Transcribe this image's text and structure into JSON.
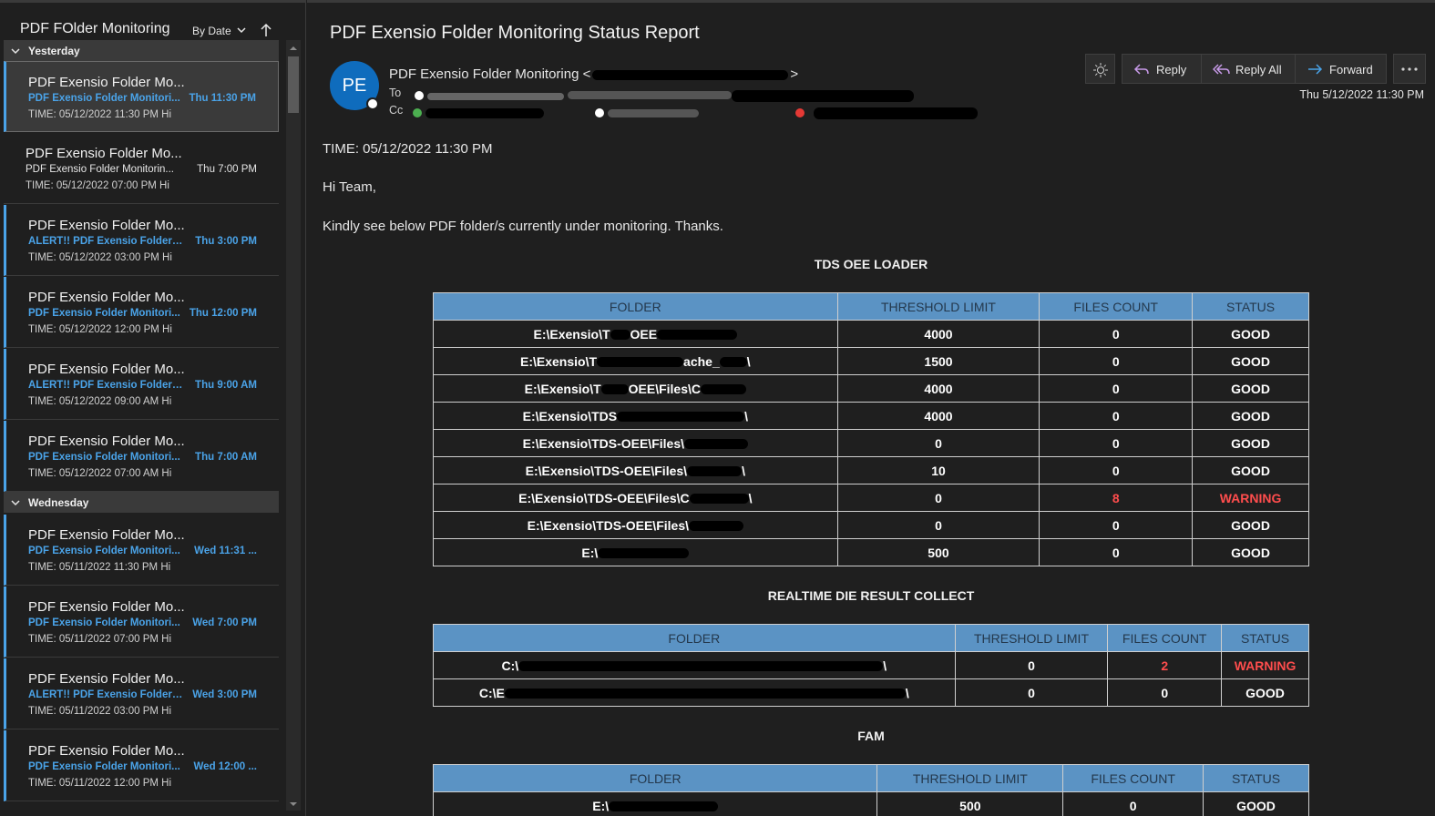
{
  "list": {
    "folder_title": "PDF FOlder Monitoring",
    "sort_label": "By Date",
    "groups": [
      {
        "label": "Yesterday"
      },
      {
        "label": "Wednesday"
      }
    ],
    "messages": [
      {
        "from": "PDF Exensio Folder Mo...",
        "subject": "PDF Exensio Folder Monitori...",
        "time": "Thu 11:30 PM",
        "preview": "TIME: 05/12/2022 11:30 PM  Hi",
        "state": "selected"
      },
      {
        "from": "PDF Exensio Folder Mo...",
        "subject": "PDF Exensio Folder Monitorin...",
        "time": "Thu 7:00 PM",
        "preview": "TIME: 05/12/2022 07:00 PM  Hi",
        "state": "read"
      },
      {
        "from": "PDF Exensio Folder Mo...",
        "subject": "ALERT!! PDF Exensio Folder ...",
        "time": "Thu 3:00 PM",
        "preview": "TIME: 05/12/2022 03:00 PM  Hi",
        "state": "unread"
      },
      {
        "from": "PDF Exensio Folder Mo...",
        "subject": "PDF Exensio Folder Monitori...",
        "time": "Thu 12:00 PM",
        "preview": "TIME: 05/12/2022 12:00 PM  Hi",
        "state": "unread"
      },
      {
        "from": "PDF Exensio Folder Mo...",
        "subject": "ALERT!! PDF Exensio Folder ...",
        "time": "Thu 9:00 AM",
        "preview": "TIME: 05/12/2022 09:00 AM  Hi",
        "state": "unread"
      },
      {
        "from": "PDF Exensio Folder Mo...",
        "subject": "PDF Exensio Folder Monitori...",
        "time": "Thu 7:00 AM",
        "preview": "TIME: 05/12/2022 07:00 AM  Hi",
        "state": "unread"
      },
      {
        "from": "PDF Exensio Folder Mo...",
        "subject": "PDF Exensio Folder Monitori...",
        "time": "Wed 11:31 ...",
        "preview": "TIME: 05/11/2022 11:30 PM  Hi",
        "state": "unread"
      },
      {
        "from": "PDF Exensio Folder Mo...",
        "subject": "PDF Exensio Folder Monitori...",
        "time": "Wed 7:00 PM",
        "preview": "TIME: 05/11/2022 07:00 PM  Hi",
        "state": "unread"
      },
      {
        "from": "PDF Exensio Folder Mo...",
        "subject": "ALERT!! PDF Exensio Folder ...",
        "time": "Wed 3:00 PM",
        "preview": "TIME: 05/11/2022 03:00 PM  Hi",
        "state": "unread"
      },
      {
        "from": "PDF Exensio Folder Mo...",
        "subject": "PDF Exensio Folder Monitori...",
        "time": "Wed 12:00 ...",
        "preview": "TIME: 05/11/2022 12:00 PM  Hi",
        "state": "unread"
      }
    ]
  },
  "email": {
    "subject": "PDF Exensio Folder Monitoring Status Report",
    "avatar_initials": "PE",
    "sender": "PDF Exensio Folder Monitoring <",
    "sender_end": ">",
    "to_label": "To",
    "cc_label": "Cc",
    "date": "Thu 5/12/2022 11:30 PM",
    "actions": {
      "reply": "Reply",
      "reply_all": "Reply All",
      "forward": "Forward"
    },
    "accent": "#0f6cbd",
    "body": {
      "time_line": "TIME: 05/12/2022 11:30 PM",
      "greeting": "Hi Team,",
      "intro": "Kindly see below PDF folder/s currently under monitoring. Thanks."
    }
  },
  "sections": [
    {
      "title": "TDS OEE LOADER",
      "headers": [
        "FOLDER",
        "THRESHOLD LIMIT",
        "FILES COUNT",
        "STATUS"
      ],
      "rows": [
        {
          "folder": "E:\\Exensio\\T",
          "folder_tail": "OEE",
          "threshold": "4000",
          "count": "0",
          "status": "GOOD"
        },
        {
          "folder": "E:\\Exensio\\T",
          "folder_tail": "ache_",
          "folder_end": "\\",
          "threshold": "1500",
          "count": "0",
          "status": "GOOD"
        },
        {
          "folder": "E:\\Exensio\\T",
          "folder_tail": "OEE\\Files\\C",
          "threshold": "4000",
          "count": "0",
          "status": "GOOD"
        },
        {
          "folder": "E:\\Exensio\\TDS",
          "folder_tail": "",
          "folder_end": "\\",
          "threshold": "4000",
          "count": "0",
          "status": "GOOD"
        },
        {
          "folder": "E:\\Exensio\\TDS-OEE\\Files\\",
          "folder_tail": "",
          "threshold": "0",
          "count": "0",
          "status": "GOOD"
        },
        {
          "folder": "E:\\Exensio\\TDS-OEE\\Files\\",
          "folder_tail": "",
          "folder_end": "\\",
          "threshold": "10",
          "count": "0",
          "status": "GOOD"
        },
        {
          "folder": "E:\\Exensio\\TDS-OEE\\Files\\C",
          "folder_tail": "",
          "folder_end": "\\",
          "threshold": "0",
          "count": "8",
          "status": "WARNING",
          "warn": true
        },
        {
          "folder": "E:\\Exensio\\TDS-OEE\\Files\\",
          "folder_tail": "",
          "threshold": "0",
          "count": "0",
          "status": "GOOD"
        },
        {
          "folder": "E:\\",
          "folder_tail": "",
          "threshold": "500",
          "count": "0",
          "status": "GOOD"
        }
      ]
    },
    {
      "title": "REALTIME DIE RESULT COLLECT",
      "headers": [
        "FOLDER",
        "THRESHOLD LIMIT",
        "FILES COUNT",
        "STATUS"
      ],
      "rows": [
        {
          "folder": "C:\\",
          "folder_tail": "",
          "folder_end": "\\",
          "threshold": "0",
          "count": "2",
          "status": "WARNING",
          "warn": true
        },
        {
          "folder": "C:\\E",
          "folder_tail": "",
          "folder_end": "\\",
          "threshold": "0",
          "count": "0",
          "status": "GOOD"
        }
      ]
    },
    {
      "title": "FAM",
      "headers": [
        "FOLDER",
        "THRESHOLD LIMIT",
        "FILES COUNT",
        "STATUS"
      ],
      "rows": [
        {
          "folder": "E:\\",
          "folder_tail": "",
          "threshold": "500",
          "count": "0",
          "status": "GOOD"
        }
      ]
    }
  ],
  "colors": {
    "unread_accent": "#4aa3e8",
    "warning": "#ff4d4d",
    "table_header": "#5b93c4",
    "presence_available": "#4caf50",
    "presence_busy": "#e53935"
  }
}
